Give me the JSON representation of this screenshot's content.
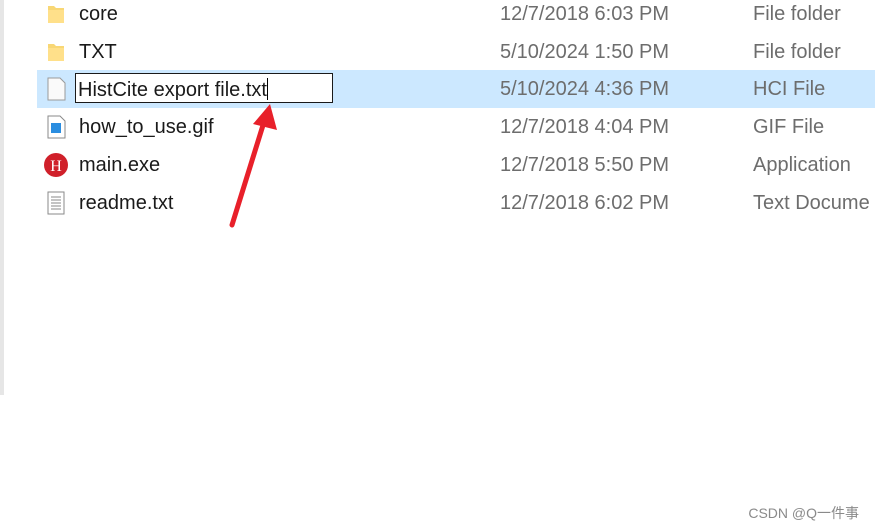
{
  "files": [
    {
      "name": "core",
      "date": "12/7/2018 6:03 PM",
      "type": "File folder",
      "icon": "folder-icon"
    },
    {
      "name": "TXT",
      "date": "5/10/2024 1:50 PM",
      "type": "File folder",
      "icon": "folder-icon"
    },
    {
      "name": "HistCite export file.txt",
      "date": "5/10/2024 4:36 PM",
      "type": "HCI File",
      "icon": "blank-file-icon",
      "selected": true,
      "renaming": true
    },
    {
      "name": "how_to_use.gif",
      "date": "12/7/2018 4:04 PM",
      "type": "GIF File",
      "icon": "image-file-icon"
    },
    {
      "name": "main.exe",
      "date": "12/7/2018 5:50 PM",
      "type": "Application",
      "icon": "histcite-app-icon"
    },
    {
      "name": "readme.txt",
      "date": "12/7/2018 6:02 PM",
      "type": "Text Docume",
      "icon": "text-file-icon"
    }
  ],
  "colors": {
    "selection": "#cce8ff",
    "arrow": "#e8202a"
  },
  "watermark": "CSDN @Q一件事"
}
